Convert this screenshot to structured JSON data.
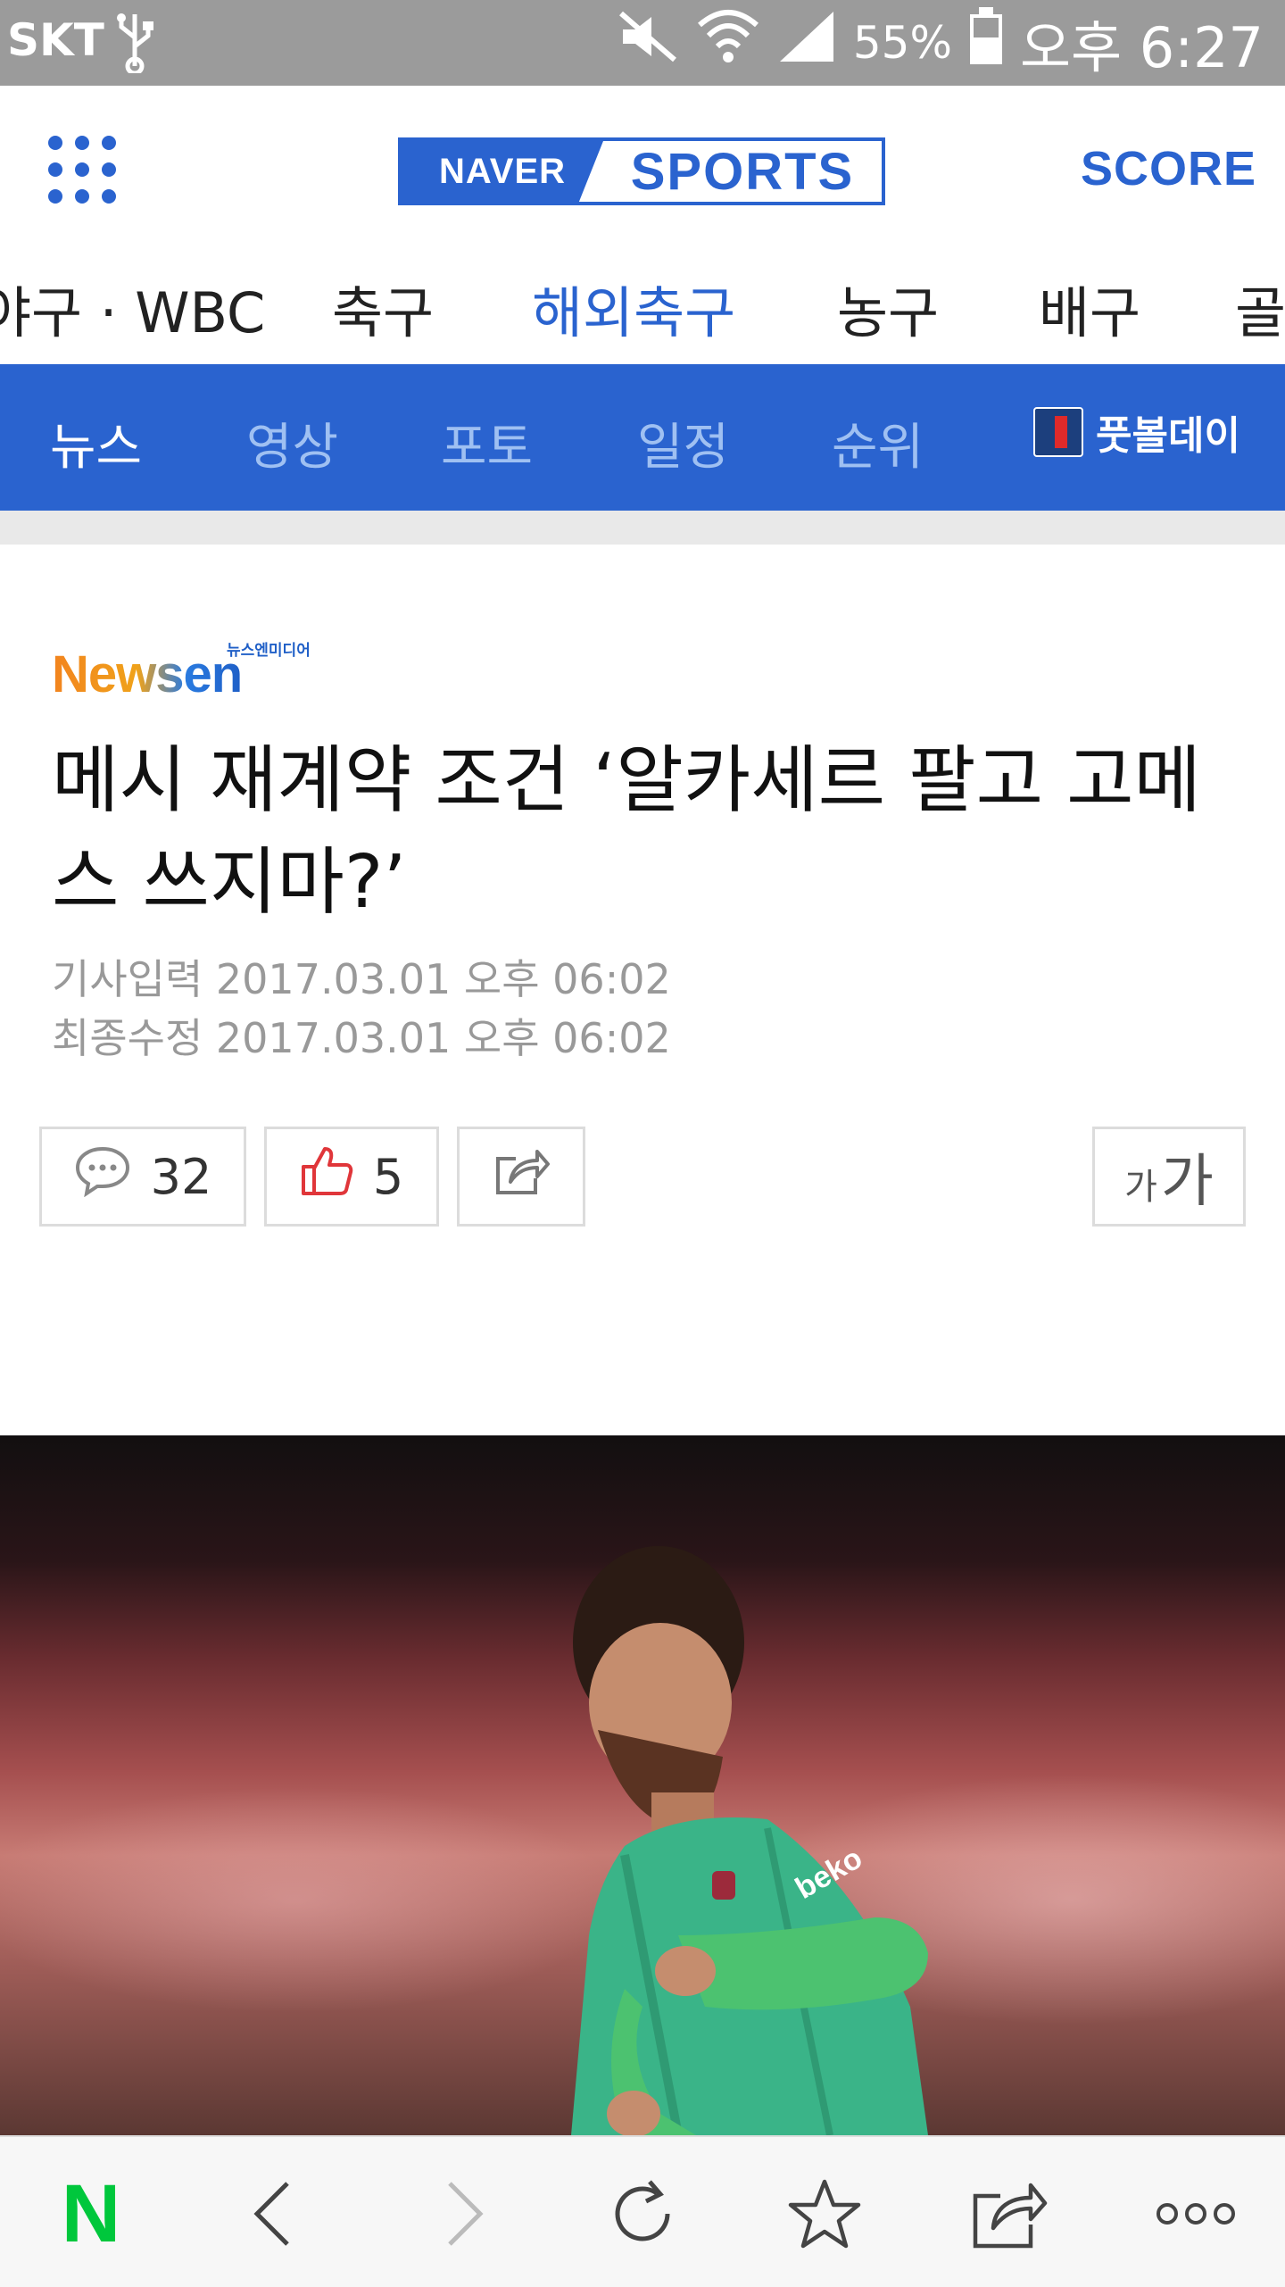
{
  "status_bar": {
    "carrier": "SKT",
    "battery_percent": "55%",
    "time": "오후 6:27",
    "icons": [
      "usb-icon",
      "mute-icon",
      "wifi-icon",
      "signal-icon",
      "battery-icon"
    ]
  },
  "header": {
    "logo_naver": "NAVER",
    "logo_sports": "SPORTS",
    "score_label": "SCORE",
    "menu_icon": "grid-menu-icon"
  },
  "categories": [
    "야구 · WBC",
    "축구",
    "해외축구",
    "농구",
    "배구",
    "골"
  ],
  "categories_active": "해외축구",
  "subtabs": {
    "items": [
      "뉴스",
      "영상",
      "포토",
      "일정",
      "순위"
    ],
    "active": "뉴스",
    "promo_label": "풋볼데이"
  },
  "article": {
    "press_logo": "Newsen",
    "press_logo_tag": "뉴스엔미디어",
    "headline": "메시 재계약 조건 ‘알카세르 팔고 고메스 쓰지마?’",
    "published": "기사입력 2017.03.01 오후 06:02",
    "modified": "최종수정 2017.03.01 오후 06:02",
    "comments_count": "32",
    "likes_count": "5",
    "font_size_small": "가",
    "font_size_large": "가"
  },
  "toolbar": {
    "home_label": "N",
    "icons": [
      "back-icon",
      "forward-icon",
      "refresh-icon",
      "bookmark-star-icon",
      "share-icon",
      "more-icon"
    ]
  },
  "colors": {
    "brand_blue": "#2a63cf",
    "naver_green": "#00c73c",
    "status_gray": "#9b9b9b"
  }
}
